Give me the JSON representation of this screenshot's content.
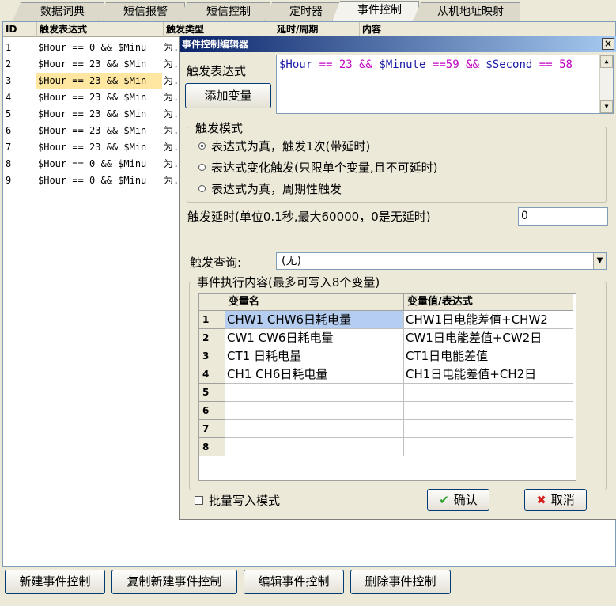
{
  "tabs": [
    "数据词典",
    "短信报警",
    "短信控制",
    "定时器",
    "事件控制",
    "从机地址映射"
  ],
  "list": {
    "columns": [
      "ID",
      "触发表达式",
      "触发类型",
      "延时/周期",
      "内容"
    ],
    "rows": [
      {
        "id": "1",
        "expr": "$Hour == 0 && $Minu",
        "type": "为."
      },
      {
        "id": "2",
        "expr": "$Hour == 23 && $Min",
        "type": "为."
      },
      {
        "id": "3",
        "expr": "$Hour == 23 && $Min",
        "type": "为."
      },
      {
        "id": "4",
        "expr": "$Hour == 23 && $Min",
        "type": "为."
      },
      {
        "id": "5",
        "expr": "$Hour == 23 && $Min",
        "type": "为."
      },
      {
        "id": "6",
        "expr": "$Hour == 23 && $Min",
        "type": "为."
      },
      {
        "id": "7",
        "expr": "$Hour == 23 && $Min",
        "type": "为."
      },
      {
        "id": "8",
        "expr": "$Hour == 0 && $Minu",
        "type": "为."
      },
      {
        "id": "9",
        "expr": "$Hour == 0 && $Minu",
        "type": "为."
      }
    ]
  },
  "bottom_buttons": {
    "new": "新建事件控制",
    "copy_new": "复制新建事件控制",
    "edit": "编辑事件控制",
    "delete": "删除事件控制"
  },
  "dialog": {
    "title": "事件控制编辑器",
    "close": "×",
    "expr_label": "触发表达式",
    "add_var": "添加变量",
    "expr_tokens": [
      {
        "t": "$Hour",
        "c": "#1a1aa6"
      },
      {
        "t": " == ",
        "c": "#c000c0"
      },
      {
        "t": "23",
        "c": "#c000c0"
      },
      {
        "t": " && ",
        "c": "#c000c0"
      },
      {
        "t": "$Minute",
        "c": "#1a1aa6"
      },
      {
        "t": " ==",
        "c": "#c000c0"
      },
      {
        "t": "59",
        "c": "#c000c0"
      },
      {
        "t": " && ",
        "c": "#c000c0"
      },
      {
        "t": "$Second",
        "c": "#1a1aa6"
      },
      {
        "t": " == ",
        "c": "#c000c0"
      },
      {
        "t": "58",
        "c": "#c000c0"
      }
    ],
    "mode_group": "触发模式",
    "modes": [
      "表达式为真，触发1次(带延时)",
      "表达式变化触发(只限单个变量,且不可延时)",
      "表达式为真，周期性触发"
    ],
    "mode_selected": 0,
    "delay_label": "触发延时(单位0.1秒,最大60000，0是无延时)",
    "delay_value": "0",
    "query_label": "触发查询:",
    "query_value": "(无)",
    "content_group": "事件执行内容(最多可写入8个变量)",
    "grid": {
      "headers": [
        "变量名",
        "变量值/表达式"
      ],
      "rows": [
        {
          "n": "1",
          "name": "CHW1  CHW6日耗电量",
          "value": "CHW1日电能差值+CHW2"
        },
        {
          "n": "2",
          "name": "CW1  CW6日耗电量",
          "value": "CW1日电能差值+CW2日"
        },
        {
          "n": "3",
          "name": "CT1  日耗电量",
          "value": "CT1日电能差值"
        },
        {
          "n": "4",
          "name": "CH1  CH6日耗电量",
          "value": "CH1日电能差值+CH2日"
        },
        {
          "n": "5",
          "name": "",
          "value": ""
        },
        {
          "n": "6",
          "name": "",
          "value": ""
        },
        {
          "n": "7",
          "name": "",
          "value": ""
        },
        {
          "n": "8",
          "name": "",
          "value": ""
        }
      ]
    },
    "batch_label": "批量写入模式",
    "ok": "确认",
    "cancel": "取消"
  },
  "colors": {
    "selection": "#ffe7a2",
    "title_bar": "#0a246a",
    "ok_icon": "#2ea02e",
    "cancel_icon": "#d62020"
  }
}
